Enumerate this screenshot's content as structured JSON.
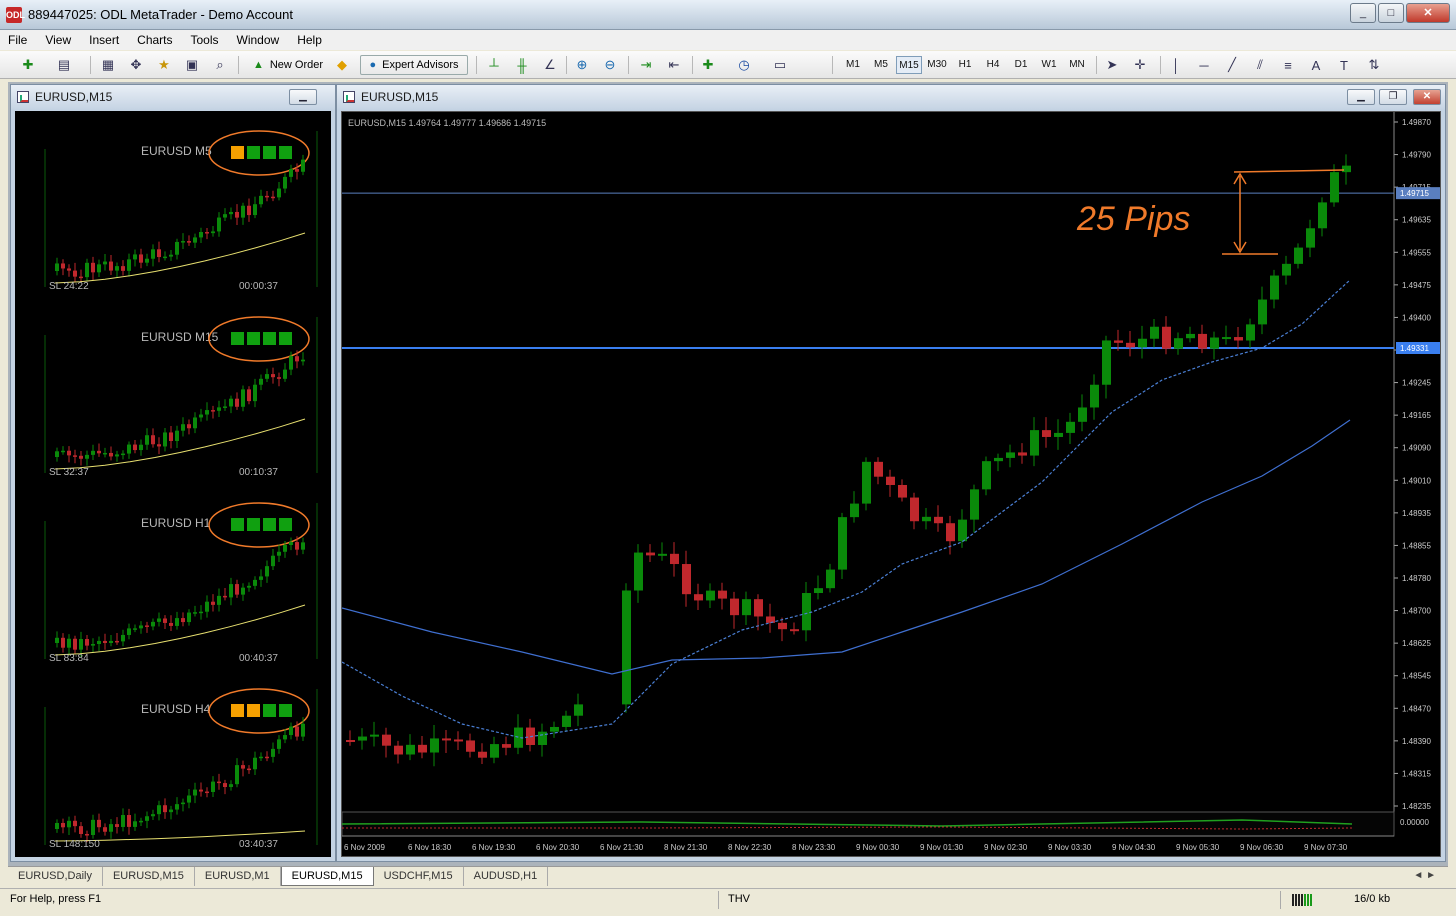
{
  "window": {
    "title": "889447025: ODL MetaTrader - Demo Account",
    "app_icon_label": "ODL",
    "controls": [
      "_",
      "□",
      "✕"
    ]
  },
  "menu": [
    "File",
    "View",
    "Insert",
    "Charts",
    "Tools",
    "Window",
    "Help"
  ],
  "toolbar": {
    "new_order_label": "New Order",
    "expert_advisors_label": "Expert Advisors",
    "timeframes": [
      "M1",
      "M5",
      "M15",
      "M30",
      "H1",
      "H4",
      "D1",
      "W1",
      "MN"
    ],
    "active_timeframe": "M15"
  },
  "left_window": {
    "title": "EURUSD,M15",
    "panels": [
      {
        "label": "EURUSD  M5",
        "blocks": [
          "orange",
          "green",
          "green",
          "green"
        ],
        "sl": "SL 24:22",
        "timer": "00:00:37"
      },
      {
        "label": "EURUSD  M15",
        "blocks": [
          "green",
          "green",
          "green",
          "green"
        ],
        "sl": "SL 32:37",
        "timer": "00:10:37"
      },
      {
        "label": "EURUSD  H1",
        "blocks": [
          "green",
          "green",
          "green",
          "green"
        ],
        "sl": "SL 83:84",
        "timer": "00:40:37"
      },
      {
        "label": "EURUSD  H4",
        "blocks": [
          "orange",
          "orange",
          "green",
          "green"
        ],
        "sl": "SL 148:150",
        "timer": "03:40:37"
      }
    ]
  },
  "main_window": {
    "title": "EURUSD,M15",
    "info": "EURUSD,M15  1.49764 1.49777 1.49686 1.49715",
    "price_labels": [
      "1.49870",
      "1.49790",
      "1.49715",
      "1.49635",
      "1.49555",
      "1.49475",
      "1.49400",
      "1.49331",
      "1.49245",
      "1.49165",
      "1.49090",
      "1.49010",
      "1.48935",
      "1.48855",
      "1.48780",
      "1.48700",
      "1.48625",
      "1.48545",
      "1.48470",
      "1.48390",
      "1.48315",
      "1.48235"
    ],
    "current_price": "1.49715",
    "level_price": "1.49331",
    "indicator_value": "0.00000",
    "time_labels": [
      "6 Nov 2009",
      "6 Nov 18:30",
      "6 Nov 19:30",
      "6 Nov 20:30",
      "6 Nov 21:30",
      "8 Nov 21:30",
      "8 Nov 22:30",
      "8 Nov 23:30",
      "9 Nov 00:30",
      "9 Nov 01:30",
      "9 Nov 02:30",
      "9 Nov 03:30",
      "9 Nov 04:30",
      "9 Nov 05:30",
      "9 Nov 06:30",
      "9 Nov 07:30"
    ],
    "annotation": "25 Pips"
  },
  "tabs": [
    "EURUSD,Daily",
    "EURUSD,M15",
    "EURUSD,M1",
    "EURUSD,M15",
    "USDCHF,M15",
    "AUDUSD,H1"
  ],
  "active_tab_index": 3,
  "status": {
    "help": "For Help, press F1",
    "profile": "THV",
    "traffic": "16/0 kb"
  },
  "colors": {
    "bull": "#0a8a0a",
    "bear": "#c0282d",
    "ma_fast": "#4a7fd4",
    "ma_slow": "#3f6fd0",
    "level": "#3a7ff0",
    "annotation": "#f07a2a",
    "ma_small": "#e8e070",
    "block_green": "#10a010",
    "block_orange": "#f5a000"
  }
}
